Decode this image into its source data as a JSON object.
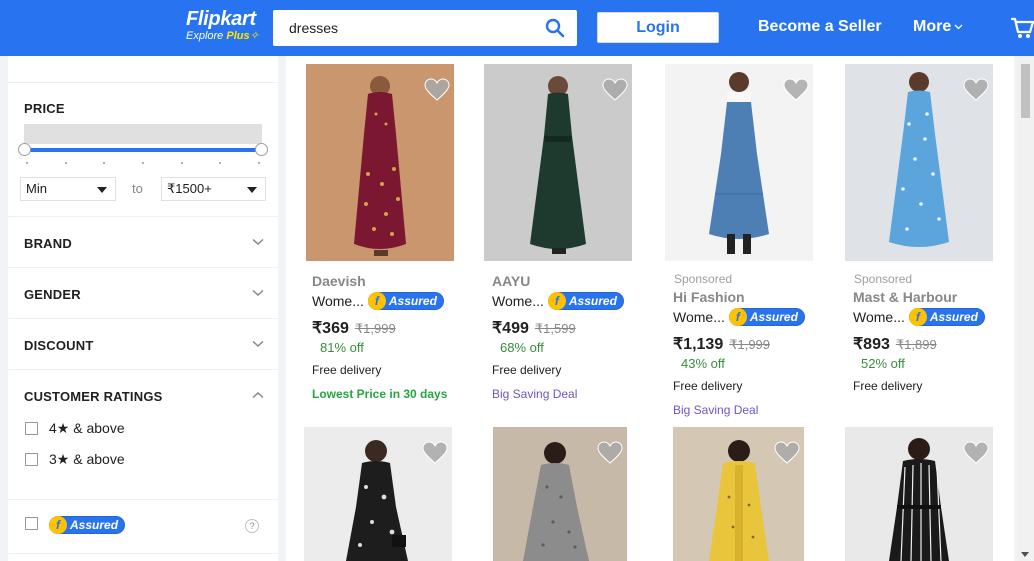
{
  "header": {
    "logo_main": "Flipkart",
    "logo_sub_prefix": "Explore",
    "logo_sub_plus": "Plus",
    "search_value": "dresses",
    "login_label": "Login",
    "seller_label": "Become a Seller",
    "more_label": "More",
    "brand_color": "#2874f0"
  },
  "sidebar": {
    "price_title": "PRICE",
    "min_select": "Min",
    "to_label": "to",
    "max_select": "₹1500+",
    "sections": [
      {
        "label": "BRAND",
        "expanded": false
      },
      {
        "label": "GENDER",
        "expanded": false
      },
      {
        "label": "DISCOUNT",
        "expanded": false
      },
      {
        "label": "CUSTOMER RATINGS",
        "expanded": true
      }
    ],
    "ratings": [
      "4★ & above",
      "3★ & above"
    ],
    "assured_label": "Assured",
    "help_label": "?"
  },
  "products": [
    {
      "sponsored": "",
      "brand": "Daevish",
      "title": "Wome...",
      "assured": "Assured",
      "price": "₹369",
      "mrp": "₹1,999",
      "off": "81% off",
      "delivery": "Free delivery",
      "tag": "Lowest Price in 30 days",
      "tag_color": "green"
    },
    {
      "sponsored": "",
      "brand": "AAYU",
      "title": "Wome...",
      "assured": "Assured",
      "price": "₹499",
      "mrp": "₹1,599",
      "off": "68% off",
      "delivery": "Free delivery",
      "tag": "Big Saving Deal",
      "tag_color": "purple"
    },
    {
      "sponsored": "Sponsored",
      "brand": "Hi Fashion",
      "title": "Wome...",
      "assured": "Assured",
      "price": "₹1,139",
      "mrp": "₹1,999",
      "off": "43% off",
      "delivery": "Free delivery",
      "tag": "Big Saving Deal",
      "tag_color": "purple"
    },
    {
      "sponsored": "Sponsored",
      "brand": "Mast & Harbour",
      "title": "Wome...",
      "assured": "Assured",
      "price": "₹893",
      "mrp": "₹1,899",
      "off": "52% off",
      "delivery": "Free delivery",
      "tag": "",
      "tag_color": ""
    }
  ]
}
